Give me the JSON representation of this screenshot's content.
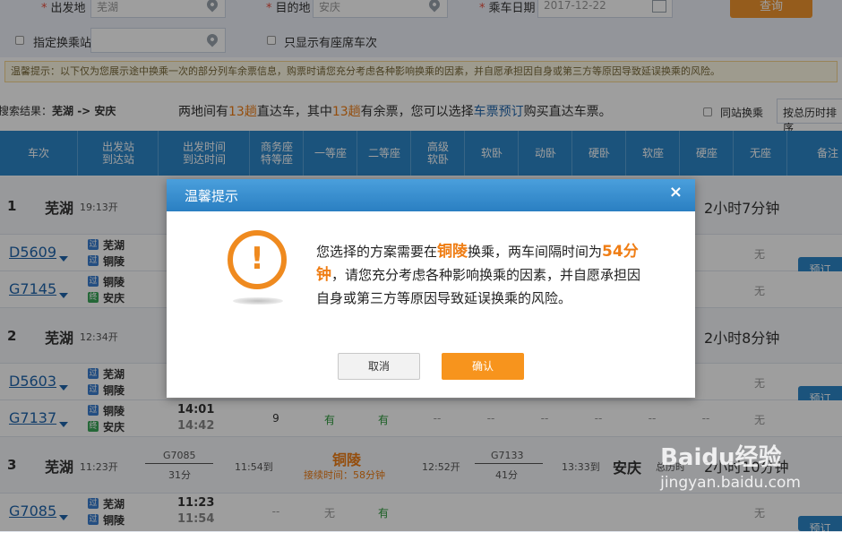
{
  "search": {
    "from_label": "出发地",
    "from_value": "芜湖",
    "to_label": "目的地",
    "to_value": "安庆",
    "date_label": "乘车日期",
    "date_value": "2017-12-22",
    "query_button": "查询",
    "transfer_station_label": "指定换乘站",
    "seat_only_label": "只显示有座席车次"
  },
  "notice": "温馨提示：以下仅为您展示途中换乘一次的部分列车余票信息，购票时请您充分考虑各种影响换乘的因素，并自愿承担因自身或第三方等原因导致延误换乘的风险。",
  "result": {
    "prefix": "搜索结果：",
    "route": "芜湖 -> 安庆",
    "summary_a": "两地间有",
    "count_direct": "13趟",
    "summary_b": "直达车，其中",
    "count_available": "13趟",
    "summary_c": "有余票，您可以选择",
    "link": "车票预订",
    "summary_d": "购买直达车票。",
    "same_station_label": "同站换乘",
    "sort_label": "按总历时排序"
  },
  "table_head": {
    "train": "车次",
    "stations": [
      "出发站",
      "到达站"
    ],
    "times": [
      "出发时间",
      "到达时间"
    ],
    "business": [
      "商务座",
      "特等座"
    ],
    "first": "一等座",
    "second": "二等座",
    "soft_sleeper_high": [
      "高级",
      "软卧"
    ],
    "soft_sleeper": "软卧",
    "motor_sleeper": "动卧",
    "hard_sleeper": "硬卧",
    "soft_seat": "软座",
    "hard_seat": "硬座",
    "no_seat": "无座",
    "note": "备注"
  },
  "groups": [
    {
      "index": "1",
      "city": "芜湖",
      "time": "19:13开",
      "duration": "2小时7分钟",
      "trains": [
        {
          "no": "D5609",
          "s1": "芜湖",
          "s2": "铜陵",
          "no_seat": "无",
          "book": "预订"
        },
        {
          "no": "G7145",
          "s1": "铜陵",
          "s2": "安庆",
          "no_seat": "无"
        }
      ]
    },
    {
      "index": "2",
      "city": "芜湖",
      "time": "12:34开",
      "duration": "2小时8分钟",
      "trains": [
        {
          "no": "D5603",
          "s1": "芜湖",
          "s2": "铜陵",
          "no_seat": "无",
          "book": "预订"
        },
        {
          "no": "G7137",
          "s1": "铜陵",
          "s2": "安庆",
          "dep": "14:01",
          "arr": "14:42",
          "business": "9",
          "first": "有",
          "second": "有",
          "dash": "--",
          "no_seat": "无"
        }
      ]
    },
    {
      "index": "3",
      "city": "芜湖",
      "time": "11:23开",
      "duration": "2小时10分钟",
      "leg1": {
        "no": "G7085",
        "mins": "31分"
      },
      "arr1": "11:54到",
      "transfer": "铜陵",
      "wait": "接续时间：58分钟",
      "dep2": "12:52开",
      "leg2": {
        "no": "G7133",
        "mins": "41分"
      },
      "arr2": "13:33到",
      "end_city": "安庆",
      "end_note": "总历时",
      "trains": [
        {
          "no": "G7085",
          "s1": "芜湖",
          "s2": "铜陵",
          "dep": "11:23",
          "arr": "11:54",
          "business": "--",
          "first": "无",
          "second": "有",
          "no_seat": "无",
          "book": "预订"
        }
      ]
    }
  ],
  "badges": {
    "pass": "过",
    "end": "终"
  },
  "dialog": {
    "title": "温馨提示",
    "close": "×",
    "msg_a": "您选择的方案需要在",
    "station": "铜陵",
    "msg_b": "换乘，两车间隔时间为",
    "interval": "54分钟",
    "msg_c": "，请您充分考虑各种影响换乘的因素，并自愿承担因自身或第三方等原因导致延误换乘的风险。",
    "cancel": "取消",
    "confirm": "确认"
  },
  "watermark": {
    "brand": "Baidu经验",
    "url": "jingyan.baidu.com"
  }
}
